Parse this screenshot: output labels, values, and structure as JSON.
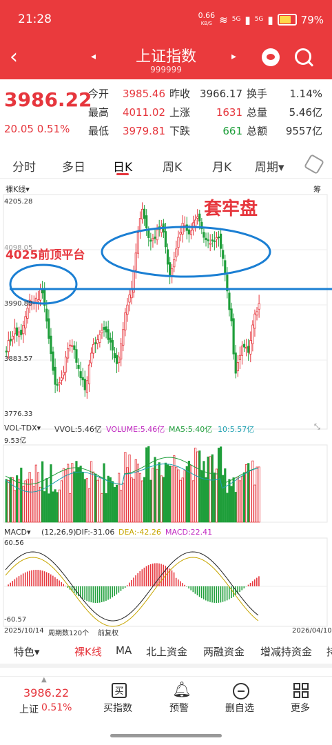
{
  "status": {
    "time": "21:28",
    "net_speed_top": "0.66",
    "net_speed_unit": "KB/S",
    "battery": "79%",
    "sig_label": "5G"
  },
  "header": {
    "title": "上证指数",
    "code": "999999"
  },
  "quote": {
    "price": "3986.22",
    "change": "20.05 0.51%",
    "rows": [
      {
        "l1": "今开",
        "v1": "3985.46",
        "l2": "昨收",
        "v2": "3966.17",
        "l3": "换手",
        "v3": "1.14%",
        "c1": "red",
        "c2": "dark",
        "c3": "dark"
      },
      {
        "l1": "最高",
        "v1": "4011.02",
        "l2": "上涨",
        "v2": "1631",
        "l3": "总量",
        "v3": "5.46亿",
        "c1": "red",
        "c2": "red",
        "c3": "dark"
      },
      {
        "l1": "最低",
        "v1": "3979.81",
        "l2": "下跌",
        "v2": "661",
        "l3": "总额",
        "v3": "9557亿",
        "c1": "red",
        "c2": "green",
        "c3": "dark"
      }
    ]
  },
  "tabs": [
    "分时",
    "多日",
    "日K",
    "周K",
    "月K",
    "周期▾"
  ],
  "chart_labels": {
    "kline_btn": "裸K线▾",
    "chou": "筹",
    "y_top": "4205.28",
    "y_mid1": "4098.05",
    "y_mid2": "3990.80",
    "y_mid3": "3883.57",
    "y_bot": "3776.33",
    "annot_top": "套牢盘",
    "annot_left": "4025前顶平台",
    "vol_btn": "VOL-TDX▾",
    "vol_vvol": "VVOL:5.46亿",
    "vol_volume": "VOLUME:5.46亿",
    "vol_ma5": "MA5:5.40亿",
    "vol_10": "10:5.57亿",
    "vol_max": "9.53亿",
    "macd_btn": "MACD▾",
    "macd_params": "(12,26,9)",
    "macd_dif": "DIF:-31.06",
    "macd_dea": "DEA:-42.26",
    "macd_val": "MACD:22.41",
    "macd_top": "60.56",
    "macd_bot": "-60.57",
    "date_left": "2025/10/14",
    "period_count": "周期数120个",
    "fq": "前复权",
    "date_right": "2026/04/10"
  },
  "colors": {
    "red": "#e6363d",
    "green": "#1e9e3a",
    "blue": "#1b7fd3",
    "header": "#ea3a3d"
  },
  "toolbar2": [
    "特色▾",
    "裸K线",
    "MA",
    "北上资金",
    "两融资金",
    "增减持资金",
    "持"
  ],
  "bottom": {
    "mini_price": "3986.22",
    "mini_name": "上证",
    "mini_change": "0.51%",
    "items": [
      {
        "label": "买指数",
        "icon": "buy-icon"
      },
      {
        "label": "预警",
        "icon": "bell-icon"
      },
      {
        "label": "删自选",
        "icon": "minus-circle-icon"
      },
      {
        "label": "更多",
        "icon": "grid-icon"
      }
    ]
  }
}
